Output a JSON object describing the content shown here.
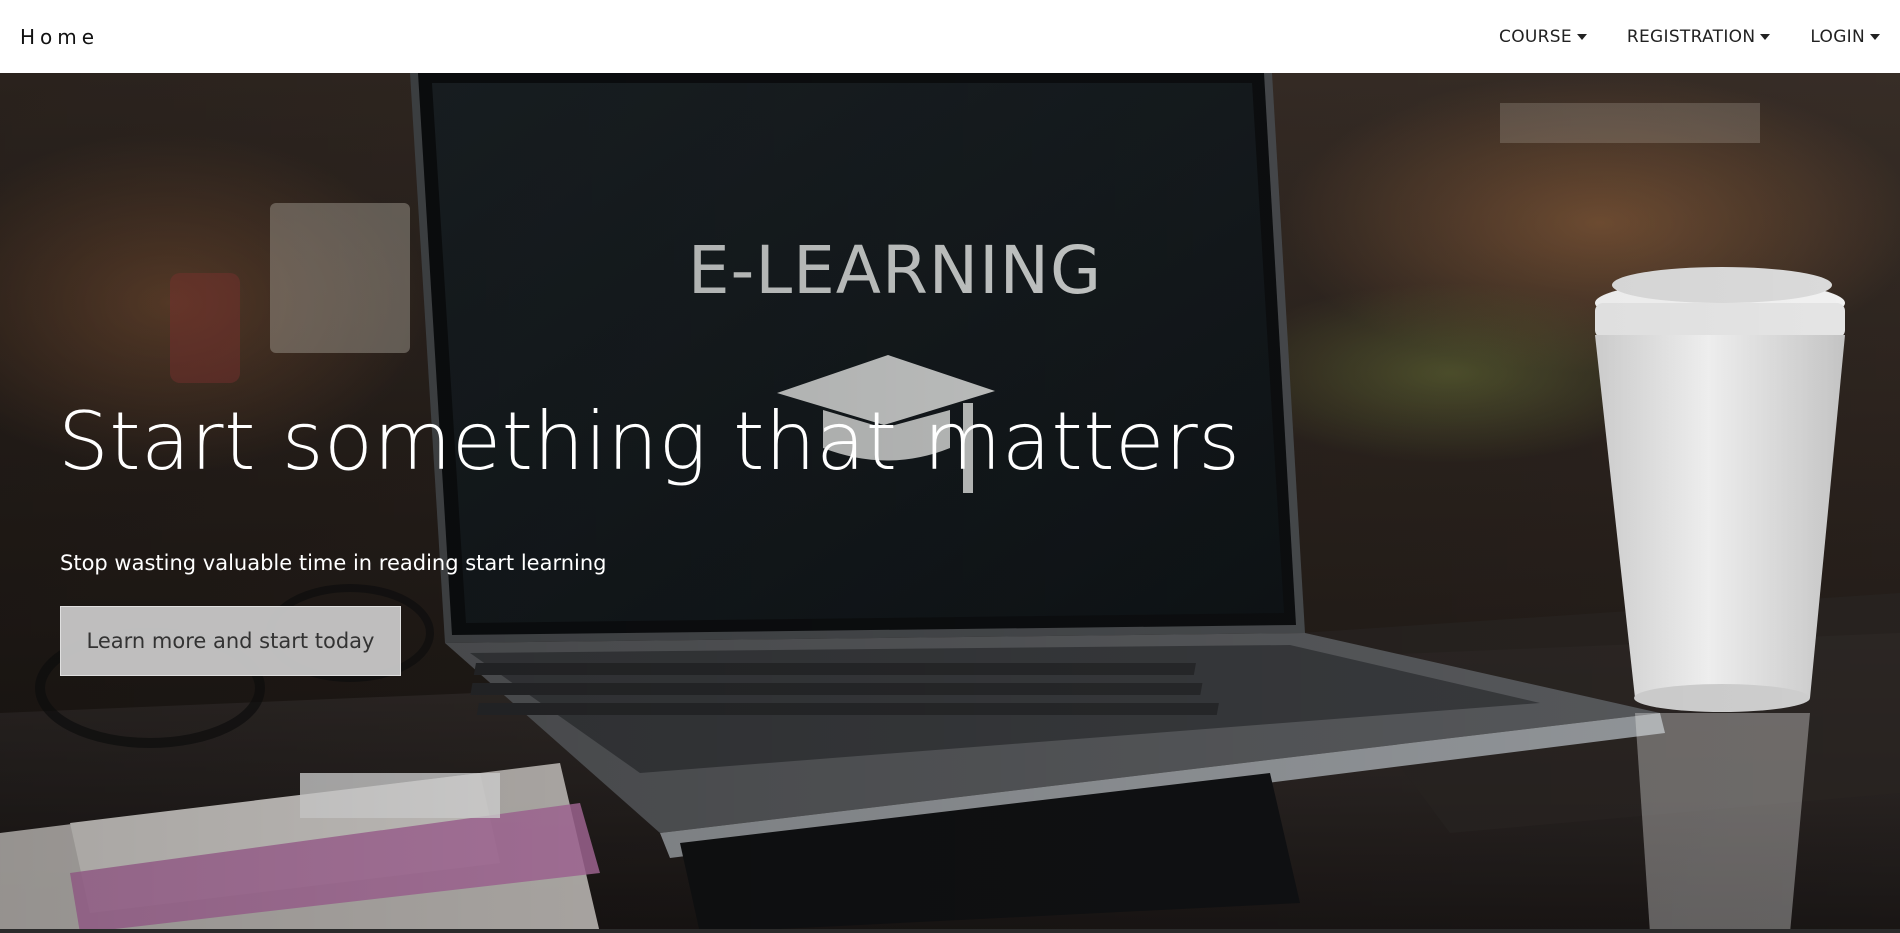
{
  "navbar": {
    "brand": "Home",
    "items": [
      {
        "label": "COURSE"
      },
      {
        "label": "REGISTRATION"
      },
      {
        "label": "LOGIN"
      }
    ]
  },
  "hero": {
    "title": "Start something that matters",
    "subtitle": "Stop wasting valuable time in reading start learning",
    "cta_label": "Learn more and start today",
    "screen_text": "E-LEARNING"
  },
  "colors": {
    "navbar_bg": "#ffffff",
    "hero_text": "#ffffff",
    "button_bg": "#cdcdcd",
    "button_text": "#333333"
  }
}
